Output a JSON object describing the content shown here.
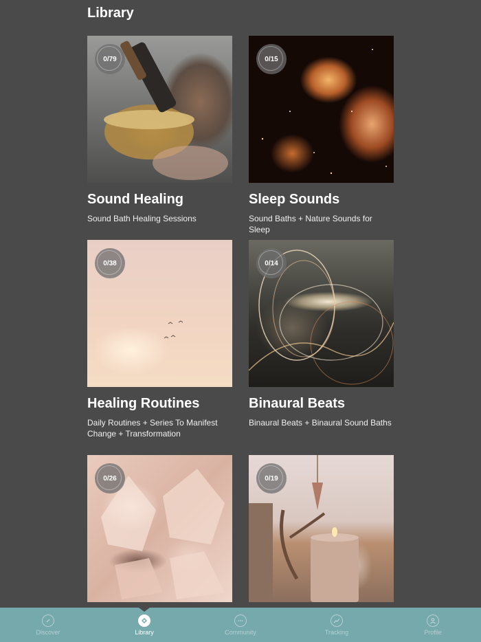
{
  "page": {
    "title": "Library"
  },
  "cards": [
    {
      "progress": "0/79",
      "title": "Sound Healing",
      "subtitle": "Sound Bath Healing Sessions",
      "image": "singing bowl photo"
    },
    {
      "progress": "0/15",
      "title": "Sleep Sounds",
      "subtitle": "Sound Baths + Nature Sounds for Sleep",
      "image": "nebula photo"
    },
    {
      "progress": "0/38",
      "title": "Healing Routines",
      "subtitle": "Daily Routines + Series To Manifest Change + Transformation",
      "image": "pink sky with birds photo"
    },
    {
      "progress": "0/14",
      "title": "Binaural Beats",
      "subtitle": "Binaural Beats + Binaural Sound Baths",
      "image": "light trails photo"
    },
    {
      "progress": "0/26",
      "title": "",
      "subtitle": "",
      "image": "crystal cluster photo"
    },
    {
      "progress": "0/19",
      "title": "",
      "subtitle": "",
      "image": "candles and pendulum photo"
    }
  ],
  "nav": {
    "items": [
      {
        "label": "Discover",
        "icon": "compass-icon",
        "active": false
      },
      {
        "label": "Library",
        "icon": "library-icon",
        "active": true
      },
      {
        "label": "Community",
        "icon": "chat-icon",
        "active": false
      },
      {
        "label": "Tracking",
        "icon": "chart-icon",
        "active": false
      },
      {
        "label": "Profile",
        "icon": "profile-icon",
        "active": false
      }
    ]
  },
  "colors": {
    "background": "#4a4a4a",
    "nav_background": "#75a9ac"
  }
}
